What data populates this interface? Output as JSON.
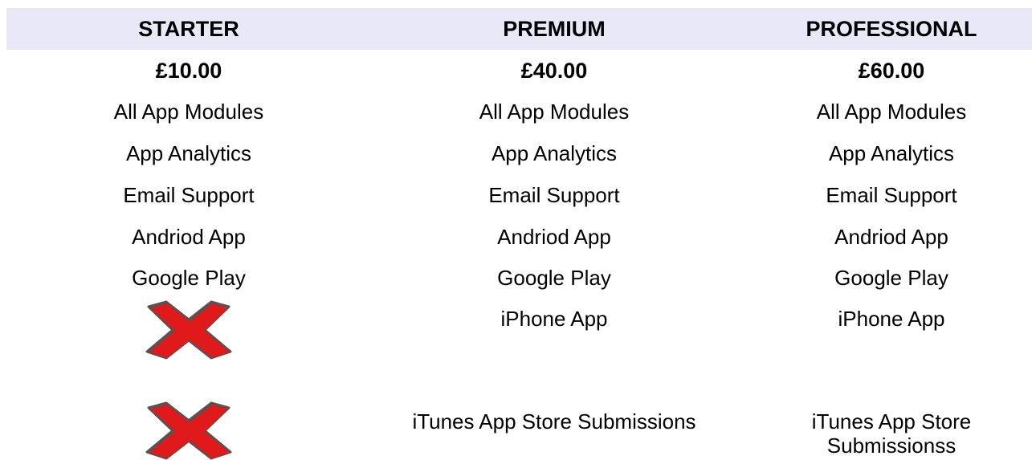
{
  "colors": {
    "header_bg": "#e8e8f8",
    "cross_fill": "#e01a1a",
    "cross_stroke": "#6b4a4a"
  },
  "plans": [
    {
      "name": "STARTER",
      "price": "£10.00",
      "features": [
        "All App Modules",
        "App Analytics",
        "Email Support",
        "Andriod App",
        "Google Play"
      ],
      "iphone_app": "not-included-icon",
      "itunes": "not-included-icon"
    },
    {
      "name": "PREMIUM",
      "price": "£40.00",
      "features": [
        "All App Modules",
        "App Analytics",
        "Email Support",
        "Andriod App",
        "Google Play"
      ],
      "iphone_app": "iPhone App",
      "itunes": "iTunes App Store Submissions"
    },
    {
      "name": "PROFESSIONAL",
      "price": "£60.00",
      "features": [
        "All App Modules",
        "App Analytics",
        "Email Support",
        "Andriod App",
        "Google Play"
      ],
      "iphone_app": "iPhone App",
      "itunes_line1": "iTunes App Store",
      "itunes_line2": "Submissionss"
    }
  ]
}
